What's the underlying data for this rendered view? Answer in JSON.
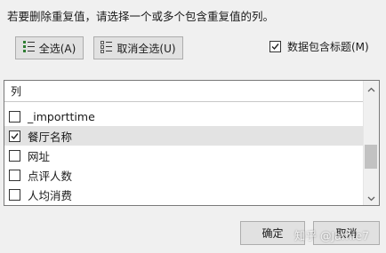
{
  "dialog": {
    "instruction": "若要删除重复值，请选择一个或多个包含重复值的列。"
  },
  "toolbar": {
    "select_all_label": "全选(A)",
    "unselect_all_label": "取消全选(U)"
  },
  "header_checkbox": {
    "label": "数据包含标题(M)",
    "checked": true
  },
  "columns": {
    "header": "列",
    "items": [
      {
        "label": "_importtime",
        "checked": false,
        "selected": false
      },
      {
        "label": "餐厅名称",
        "checked": true,
        "selected": true
      },
      {
        "label": "网址",
        "checked": false,
        "selected": false
      },
      {
        "label": "点评人数",
        "checked": false,
        "selected": false
      },
      {
        "label": "人均消费",
        "checked": false,
        "selected": false
      }
    ]
  },
  "footer": {
    "ok_label": "确定",
    "cancel_label": "取消"
  },
  "watermark": {
    "text": "知乎 @Jamie7"
  },
  "icons": {
    "select_all": "checklist-icon",
    "unselect_all": "unchecked-list-icon"
  }
}
